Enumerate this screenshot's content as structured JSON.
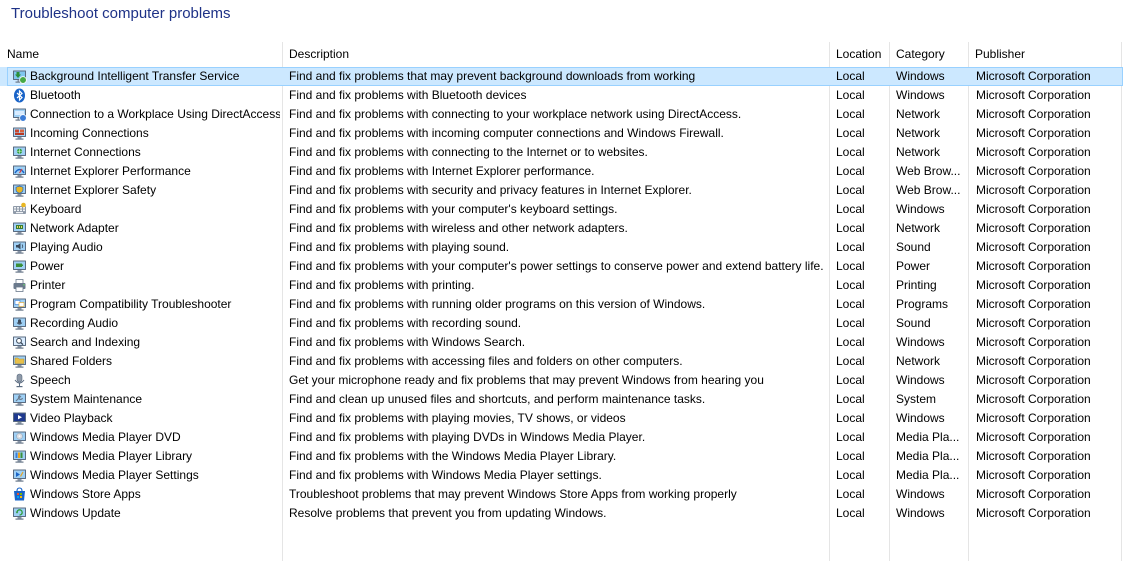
{
  "page": {
    "title": "Troubleshoot computer problems"
  },
  "columns": {
    "name": "Name",
    "description": "Description",
    "location": "Location",
    "category": "Category",
    "publisher": "Publisher"
  },
  "colors": {
    "title": "#1e3287",
    "selected_row": "#cce8ff",
    "selected_border": "#99d1ff",
    "grid_line": "#e5e5e5"
  },
  "rows": [
    {
      "name": "Background Intelligent Transfer Service",
      "description": "Find and fix problems that may prevent background downloads from working",
      "location": "Local",
      "category": "Windows",
      "publisher": "Microsoft Corporation",
      "icon": "bits-icon",
      "selected": true
    },
    {
      "name": "Bluetooth",
      "description": "Find and fix problems with Bluetooth devices",
      "location": "Local",
      "category": "Windows",
      "publisher": "Microsoft Corporation",
      "icon": "bluetooth-icon"
    },
    {
      "name": "Connection to a Workplace Using DirectAccess",
      "description": "Find and fix problems with connecting to your workplace network using DirectAccess.",
      "location": "Local",
      "category": "Network",
      "publisher": "Microsoft Corporation",
      "icon": "directaccess-icon"
    },
    {
      "name": "Incoming Connections",
      "description": "Find and fix problems with incoming computer connections and Windows Firewall.",
      "location": "Local",
      "category": "Network",
      "publisher": "Microsoft Corporation",
      "icon": "incoming-connections-icon"
    },
    {
      "name": "Internet Connections",
      "description": "Find and fix problems with connecting to the Internet or to websites.",
      "location": "Local",
      "category": "Network",
      "publisher": "Microsoft Corporation",
      "icon": "internet-connections-icon"
    },
    {
      "name": "Internet Explorer Performance",
      "description": "Find and fix problems with Internet Explorer performance.",
      "location": "Local",
      "category": "Web Brow...",
      "publisher": "Microsoft Corporation",
      "icon": "ie-performance-icon"
    },
    {
      "name": "Internet Explorer Safety",
      "description": "Find and fix problems with security and privacy features in Internet Explorer.",
      "location": "Local",
      "category": "Web Brow...",
      "publisher": "Microsoft Corporation",
      "icon": "ie-safety-icon"
    },
    {
      "name": "Keyboard",
      "description": "Find and fix problems with your computer's keyboard settings.",
      "location": "Local",
      "category": "Windows",
      "publisher": "Microsoft Corporation",
      "icon": "keyboard-icon"
    },
    {
      "name": "Network Adapter",
      "description": "Find and fix problems with wireless and other network adapters.",
      "location": "Local",
      "category": "Network",
      "publisher": "Microsoft Corporation",
      "icon": "network-adapter-icon"
    },
    {
      "name": "Playing Audio",
      "description": "Find and fix problems with playing sound.",
      "location": "Local",
      "category": "Sound",
      "publisher": "Microsoft Corporation",
      "icon": "playing-audio-icon"
    },
    {
      "name": "Power",
      "description": "Find and fix problems with your computer's power settings to conserve power and extend battery life.",
      "location": "Local",
      "category": "Power",
      "publisher": "Microsoft Corporation",
      "icon": "power-icon"
    },
    {
      "name": "Printer",
      "description": "Find and fix problems with printing.",
      "location": "Local",
      "category": "Printing",
      "publisher": "Microsoft Corporation",
      "icon": "printer-icon"
    },
    {
      "name": "Program Compatibility Troubleshooter",
      "description": "Find and fix problems with running older programs on this version of Windows.",
      "location": "Local",
      "category": "Programs",
      "publisher": "Microsoft Corporation",
      "icon": "program-compatibility-icon"
    },
    {
      "name": "Recording Audio",
      "description": "Find and fix problems with recording sound.",
      "location": "Local",
      "category": "Sound",
      "publisher": "Microsoft Corporation",
      "icon": "recording-audio-icon"
    },
    {
      "name": "Search and Indexing",
      "description": "Find and fix problems with Windows Search.",
      "location": "Local",
      "category": "Windows",
      "publisher": "Microsoft Corporation",
      "icon": "search-indexing-icon"
    },
    {
      "name": "Shared Folders",
      "description": "Find and fix problems with accessing files and folders on other computers.",
      "location": "Local",
      "category": "Network",
      "publisher": "Microsoft Corporation",
      "icon": "shared-folders-icon"
    },
    {
      "name": "Speech",
      "description": "Get your microphone ready and fix problems that may prevent Windows from hearing you",
      "location": "Local",
      "category": "Windows",
      "publisher": "Microsoft Corporation",
      "icon": "speech-icon"
    },
    {
      "name": "System Maintenance",
      "description": "Find and clean up unused files and shortcuts, and perform maintenance tasks.",
      "location": "Local",
      "category": "System",
      "publisher": "Microsoft Corporation",
      "icon": "system-maintenance-icon"
    },
    {
      "name": "Video Playback",
      "description": "Find and fix problems with playing movies, TV shows, or videos",
      "location": "Local",
      "category": "Windows",
      "publisher": "Microsoft Corporation",
      "icon": "video-playback-icon"
    },
    {
      "name": "Windows Media Player DVD",
      "description": "Find and fix problems with playing DVDs in Windows Media Player.",
      "location": "Local",
      "category": "Media Pla...",
      "publisher": "Microsoft Corporation",
      "icon": "wmp-dvd-icon"
    },
    {
      "name": "Windows Media Player Library",
      "description": "Find and fix problems with the Windows Media Player Library.",
      "location": "Local",
      "category": "Media Pla...",
      "publisher": "Microsoft Corporation",
      "icon": "wmp-library-icon"
    },
    {
      "name": "Windows Media Player Settings",
      "description": "Find and fix problems with Windows Media Player settings.",
      "location": "Local",
      "category": "Media Pla...",
      "publisher": "Microsoft Corporation",
      "icon": "wmp-settings-icon"
    },
    {
      "name": "Windows Store Apps",
      "description": "Troubleshoot problems that may prevent Windows Store Apps from working properly",
      "location": "Local",
      "category": "Windows",
      "publisher": "Microsoft Corporation",
      "icon": "store-apps-icon"
    },
    {
      "name": "Windows Update",
      "description": "Resolve problems that prevent you from updating Windows.",
      "location": "Local",
      "category": "Windows",
      "publisher": "Microsoft Corporation",
      "icon": "windows-update-icon"
    }
  ]
}
